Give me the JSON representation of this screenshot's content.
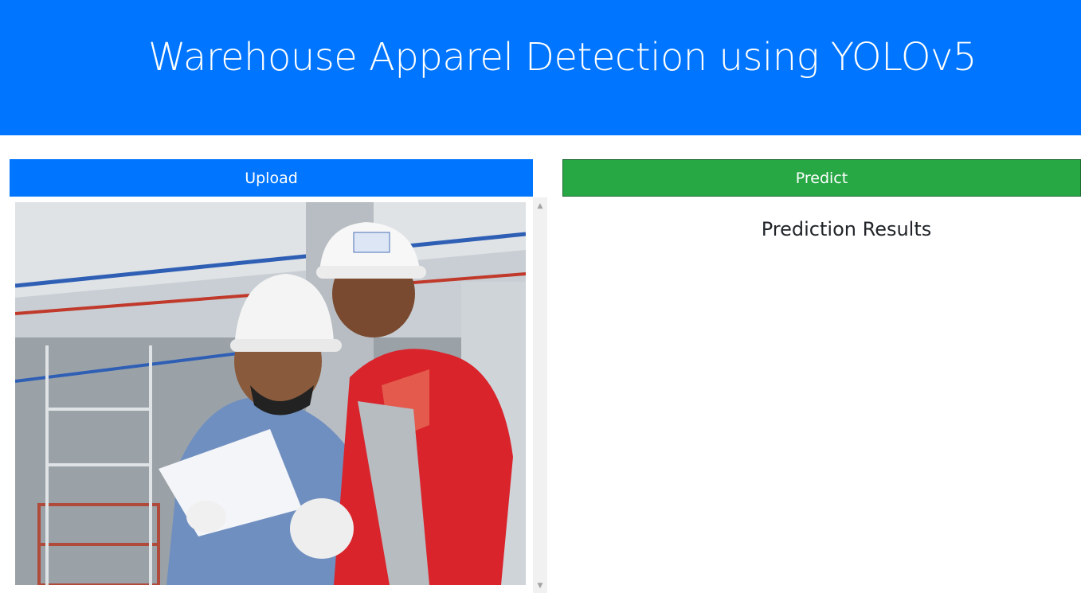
{
  "header": {
    "title": "Warehouse Apparel Detection using YOLOv5"
  },
  "controls": {
    "upload_label": "Upload",
    "predict_label": "Predict"
  },
  "results": {
    "title": "Prediction Results"
  },
  "image": {
    "subject": "two construction workers wearing hard hats reviewing papers"
  },
  "colors": {
    "primary": "#0075ff",
    "success": "#28a745",
    "text": "#212529"
  }
}
